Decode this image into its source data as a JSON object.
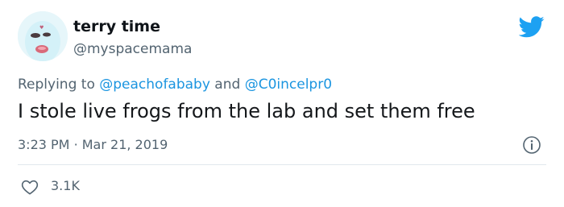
{
  "author": {
    "display_name": "terry time",
    "handle": "@myspacemama"
  },
  "reply": {
    "prefix": "Replying to ",
    "mention1": "@peachofababy",
    "connector": " and ",
    "mention2": "@C0incelpr0"
  },
  "tweet": {
    "text": "I stole live frogs from the lab and set them free",
    "time": "3:23 PM",
    "separator": "·",
    "date": "Mar 21, 2019"
  },
  "stats": {
    "likes": "3.1K"
  },
  "icons": {
    "brand": "twitter-bird-icon",
    "info": "info-icon",
    "like": "heart-icon"
  },
  "colors": {
    "brand": "#1da1f2",
    "mention": "#1b95e0",
    "muted": "#536471"
  }
}
